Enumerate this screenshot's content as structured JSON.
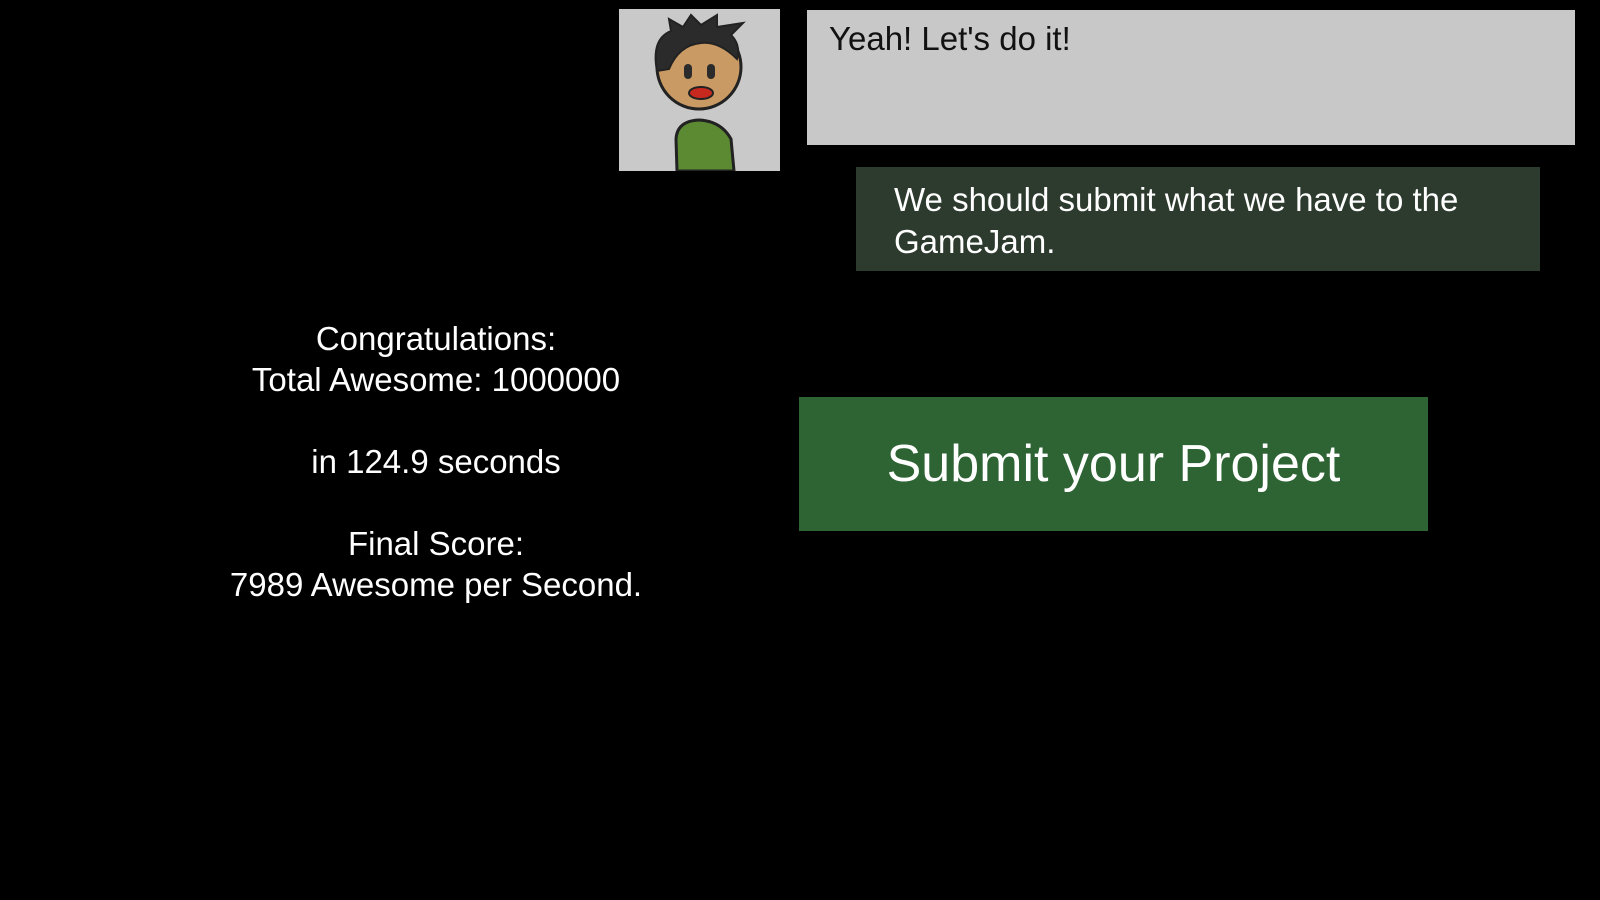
{
  "dialogue": {
    "speaker_avatar_icon": "character-portrait",
    "speech": "Yeah! Let's do it!",
    "choice": "We should submit what we have to the GameJam."
  },
  "results": {
    "heading": "Congratulations:",
    "total_awesome": "Total Awesome: 1000000",
    "time": "in 124.9 seconds",
    "final_score_label": "Final Score:",
    "final_score_value": "7989 Awesome per Second."
  },
  "actions": {
    "submit_label": "Submit your Project"
  },
  "colors": {
    "background": "#000000",
    "speech_box": "#c8c8c8",
    "choice_box": "#2d3b2e",
    "submit_button": "#2e6434",
    "shirt": "#5c8a33",
    "skin": "#c99a63"
  }
}
